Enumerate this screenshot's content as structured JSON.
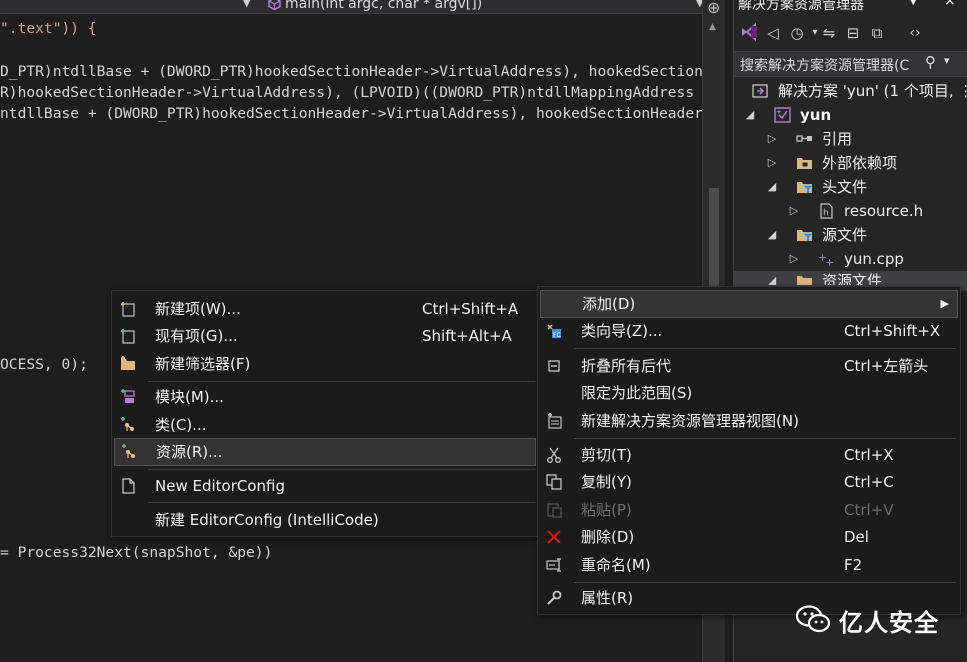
{
  "editor": {
    "nav_left": "",
    "nav_right": "main(int argc, char * argv[])",
    "code_lines": [
      {
        "line": "\".text\")) {"
      },
      {
        "line": "D_PTR)ntdllBase + (DWORD_PTR)hookedSectionHeader->VirtualAddress), hookedSectionH"
      },
      {
        "line": "R)hookedSectionHeader->VirtualAddress), (LPVOID)((DWORD_PTR)ntdllMappingAddress +"
      },
      {
        "line": "ntdllBase + (DWORD_PTR)hookedSectionHeader->VirtualAddress), hookedSectionHeader"
      },
      {
        "line": "OCESS, 0);"
      },
      {
        "line": "= Process32Next(snapShot, &pe))"
      }
    ]
  },
  "solution_explorer": {
    "title": "解决方案资源管理器",
    "search_placeholder": "搜索解决方案资源管理器(C",
    "tree": [
      {
        "label": "解决方案 'yun' (1 个项目, ⋮",
        "icon": "solution-icon"
      },
      {
        "label": "yun",
        "icon": "project-icon"
      },
      {
        "label": "引用",
        "icon": "references-icon"
      },
      {
        "label": "外部依赖项",
        "icon": "external-deps-icon"
      },
      {
        "label": "头文件",
        "icon": "folder-filter-icon"
      },
      {
        "label": "resource.h",
        "icon": "header-file-icon"
      },
      {
        "label": "源文件",
        "icon": "folder-filter-icon"
      },
      {
        "label": "yun.cpp",
        "icon": "cpp-file-icon"
      },
      {
        "label": "资源文件",
        "icon": "folder-filter-icon"
      }
    ]
  },
  "left_menu": {
    "items": [
      {
        "label": "新建项(W)...",
        "shortcut": "Ctrl+Shift+A",
        "icon": "new-item-icon"
      },
      {
        "label": "现有项(G)...",
        "shortcut": "Shift+Alt+A",
        "icon": "existing-item-icon"
      },
      {
        "label": "新建筛选器(F)",
        "shortcut": "",
        "icon": "new-filter-icon"
      },
      {
        "label": "模块(M)...",
        "shortcut": "",
        "icon": "module-icon"
      },
      {
        "label": "类(C)...",
        "shortcut": "",
        "icon": "class-icon"
      },
      {
        "label": "资源(R)...",
        "shortcut": "",
        "icon": "resource-icon"
      },
      {
        "label": "New EditorConfig",
        "shortcut": "",
        "icon": "editorconfig-icon"
      },
      {
        "label": "新建 EditorConfig (IntelliCode)",
        "shortcut": "",
        "icon": ""
      }
    ]
  },
  "right_menu": {
    "items": [
      {
        "label": "添加(D)",
        "shortcut": "",
        "icon": ""
      },
      {
        "label": "类向导(Z)...",
        "shortcut": "Ctrl+Shift+X",
        "icon": "class-wizard-icon"
      },
      {
        "label": "折叠所有后代",
        "shortcut": "Ctrl+左箭头",
        "icon": "collapse-icon"
      },
      {
        "label": "限定为此范围(S)",
        "shortcut": "",
        "icon": ""
      },
      {
        "label": "新建解决方案资源管理器视图(N)",
        "shortcut": "",
        "icon": "new-view-icon"
      },
      {
        "label": "剪切(T)",
        "shortcut": "Ctrl+X",
        "icon": "cut-icon"
      },
      {
        "label": "复制(Y)",
        "shortcut": "Ctrl+C",
        "icon": "copy-icon"
      },
      {
        "label": "粘贴(P)",
        "shortcut": "Ctrl+V",
        "icon": "paste-icon"
      },
      {
        "label": "删除(D)",
        "shortcut": "Del",
        "icon": "delete-icon"
      },
      {
        "label": "重命名(M)",
        "shortcut": "F2",
        "icon": "rename-icon"
      },
      {
        "label": "属性(R)",
        "shortcut": "",
        "icon": "properties-icon"
      }
    ]
  },
  "watermark": {
    "text": "亿人安全"
  },
  "colors": {
    "background": "#1e1e1e",
    "panel": "#252526",
    "menu": "#1b1b1c",
    "accent_purple": "#b180d7",
    "delete_red": "#e51400"
  }
}
